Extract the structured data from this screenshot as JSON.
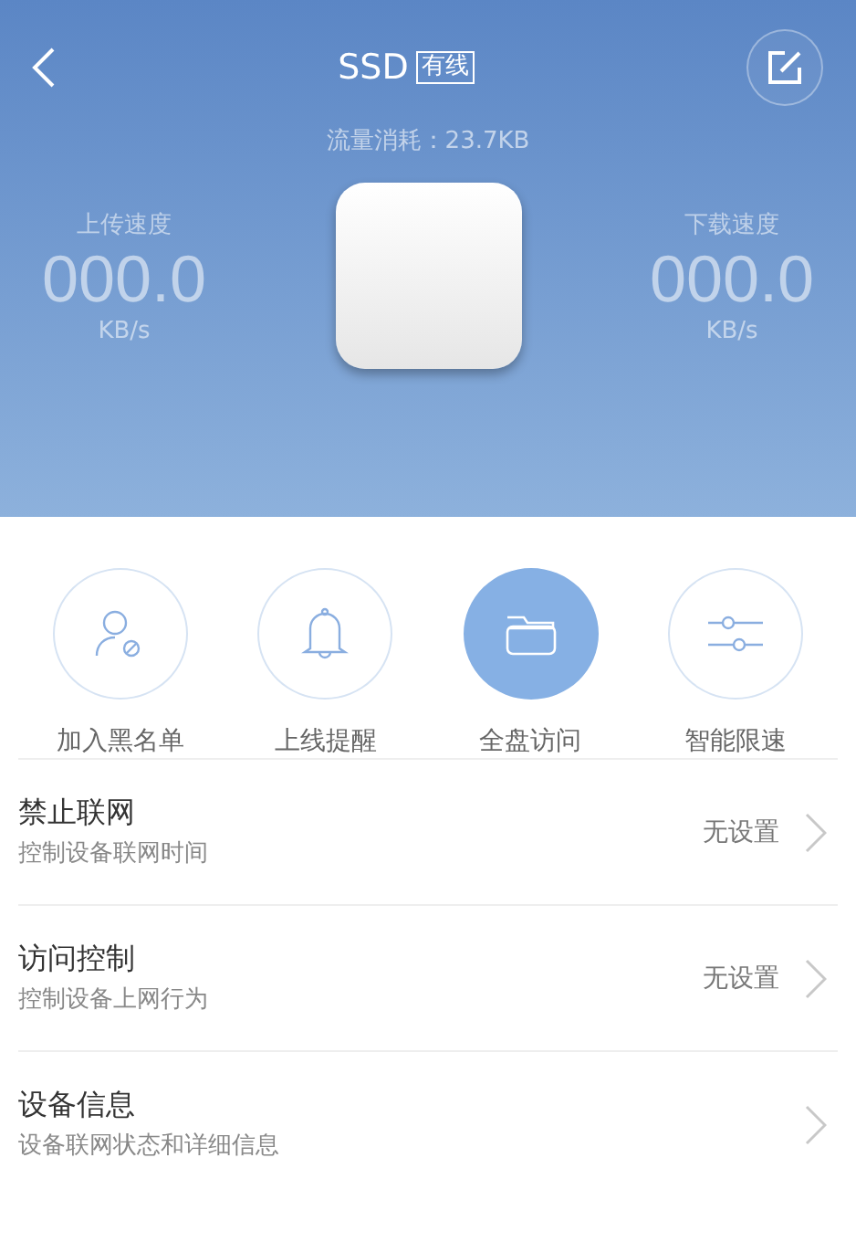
{
  "header": {
    "title": "SSD",
    "connection_tag": "有线",
    "traffic": "流量消耗：23.7KB",
    "upload": {
      "label": "上传速度",
      "value": "000.0",
      "unit": "KB/s"
    },
    "download": {
      "label": "下载速度",
      "value": "000.0",
      "unit": "KB/s"
    }
  },
  "actions": [
    {
      "kind": "blacklist",
      "label": "加入黑名单",
      "selected": false
    },
    {
      "kind": "bell",
      "label": "上线提醒",
      "selected": false
    },
    {
      "kind": "folder",
      "label": "全盘访问",
      "selected": true
    },
    {
      "kind": "sliders",
      "label": "智能限速",
      "selected": false
    }
  ],
  "settings": [
    {
      "title": "禁止联网",
      "subtitle": "控制设备联网时间",
      "value": "无设置"
    },
    {
      "title": "访问控制",
      "subtitle": "控制设备上网行为",
      "value": "无设置"
    },
    {
      "title": "设备信息",
      "subtitle": "设备联网状态和详细信息"
    }
  ]
}
